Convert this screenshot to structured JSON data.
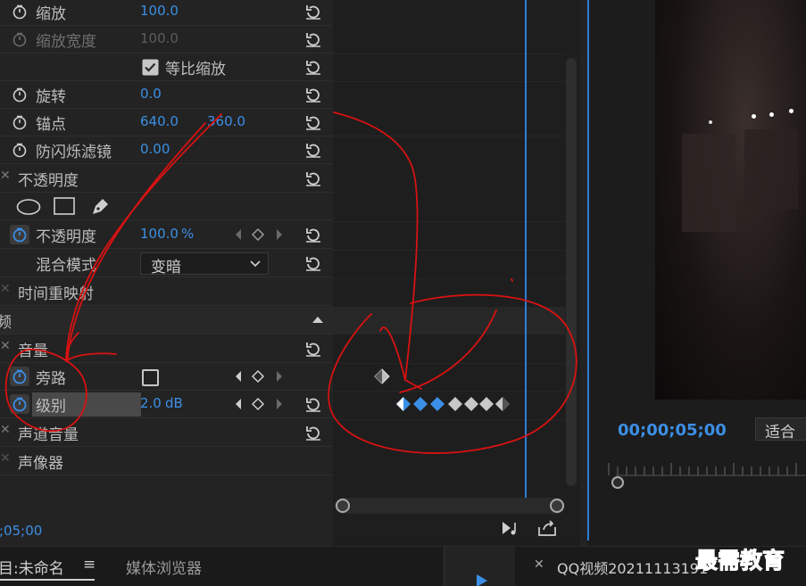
{
  "effect_controls": {
    "scale": {
      "label": "缩放",
      "value": "100.0"
    },
    "scale_width": {
      "label": "缩放宽度",
      "value": "100.0"
    },
    "uniform_scale": {
      "label": "等比缩放"
    },
    "rotation": {
      "label": "旋转",
      "value": "0.0"
    },
    "anchor": {
      "label": "锚点",
      "x": "640.0",
      "y": "360.0"
    },
    "anti_flicker": {
      "label": "防闪烁滤镜",
      "value": "0.00"
    },
    "opacity_group": {
      "label": "不透明度"
    },
    "opacity": {
      "label": "不透明度",
      "value": "100.0",
      "unit": "%"
    },
    "blend_mode": {
      "label": "混合模式",
      "value": "变暗"
    },
    "time_remap": {
      "label": "时间重映射"
    },
    "audio_section": {
      "label": "频"
    },
    "volume": {
      "label": "音量"
    },
    "bypass": {
      "label": "旁路"
    },
    "level": {
      "label": "级别",
      "value": "2.0",
      "unit": "dB"
    },
    "channel_volume": {
      "label": "声道音量"
    },
    "panner": {
      "label": "声像器"
    },
    "timecode": ";05;00"
  },
  "program_monitor": {
    "timecode": "00;00;05;00",
    "fit": "适合"
  },
  "bottom": {
    "project_tab": "目:未命名",
    "media_browser": "媒体浏览器",
    "source_tab": "QQ视频20211113191",
    "watermark": "最需教育"
  },
  "colors": {
    "accent": "#3c8fe6",
    "annotation": "#d81212",
    "keyframe": "#3c8fe6"
  }
}
